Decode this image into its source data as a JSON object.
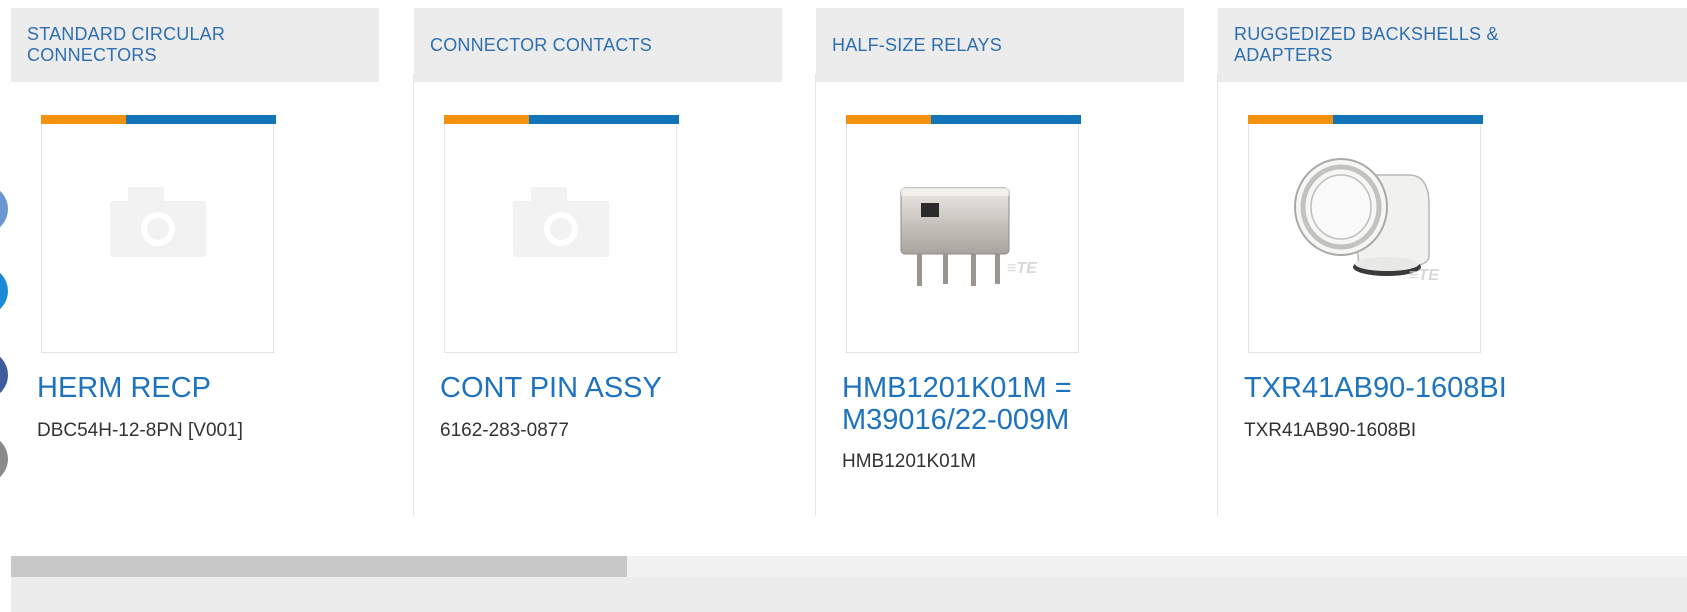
{
  "share_buttons": [
    {
      "icon": "share-circle-icon",
      "color": "#6a97cf"
    },
    {
      "icon": "share-circle-icon",
      "color": "#1a8ad4"
    },
    {
      "icon": "share-circle-icon",
      "color": "#3e5c9e"
    },
    {
      "icon": "share-circle-icon",
      "color": "#8a8a8a"
    }
  ],
  "colors": {
    "accent_orange": "#f2920e",
    "accent_blue": "#1374b8",
    "link_blue": "#1e73be"
  },
  "cards": [
    {
      "category": "STANDARD CIRCULAR CONNECTORS",
      "image": "camera-placeholder-icon",
      "title": "HERM RECP",
      "part_number": "DBC54H-12-8PN [V001]"
    },
    {
      "category": "CONNECTOR CONTACTS",
      "image": "camera-placeholder-icon",
      "title": "CONT PIN ASSY",
      "part_number": "6162-283-0877"
    },
    {
      "category": "HALF-SIZE RELAYS",
      "image": "relay-product-image",
      "title": "HMB1201K01M = M39016/22-009M",
      "part_number": "HMB1201K01M"
    },
    {
      "category": "RUGGEDIZED BACKSHELLS & ADAPTERS",
      "image": "backshell-product-image",
      "title": "TXR41AB90-1608BI",
      "part_number": "TXR41AB90-1608BI"
    }
  ],
  "scroll": {
    "thumb_fraction": 0.37
  }
}
